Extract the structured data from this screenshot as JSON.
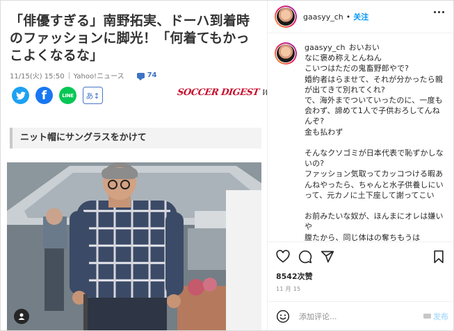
{
  "article": {
    "headline": "「俳優すぎる」南野拓実、ドーハ到着時のファッションに脚光！「何着てもかっこよくなるな」",
    "date": "11/15(火) 15:50",
    "source": "Yahoo!ニュース",
    "comment_count": "74",
    "share_buttons": [
      "twitter-icon",
      "facebook-icon",
      "line-icon"
    ],
    "line_label": "LINE",
    "font_size_label": "あ↕",
    "brand_main": "SOCCER DIGEST",
    "brand_suffix": "Web",
    "subheading": "ニット帽にサングラスをかけて"
  },
  "post": {
    "username": "gaasyy_ch",
    "dot": "•",
    "follow_label": "关注",
    "caption": "おいおい\nなに褒め称えとんねん\nこいつはただの鬼畜野郎やで?\n婚約者はらませて、それが分かったら親が出てきて別れてくれ?\nで、海外までついていったのに、一度も会わず、諦めて1人で子供おろしてんねんぞ?\n金も払わず\n\nそんなクソゴミが日本代表で恥ずかしないの?\nファッション気取ってカッコつける暇あんねやったら、ちゃんと水子供養しにいって、元カノに土下座して謝ってこい\n\nお前みたいな奴が、ほんまにオレは嫌いや\n腹たから、同じ体はの奪ちもうは",
    "likes": "8542次赞",
    "date": "11 月 15",
    "comment_placeholder": "添加评论...",
    "post_label": "发布"
  },
  "colors": {
    "brand_red": "#c8102e",
    "link_blue": "#0095f6",
    "post_disabled": "#b2dffc"
  }
}
